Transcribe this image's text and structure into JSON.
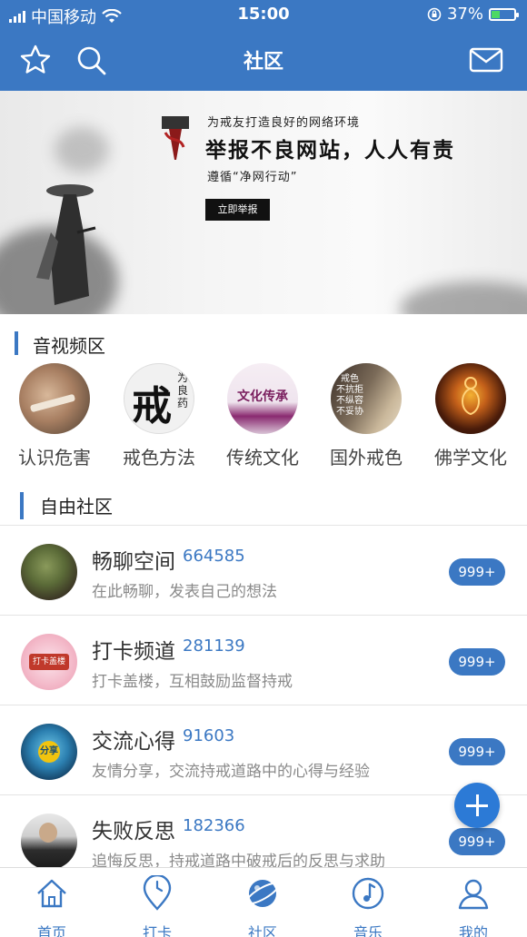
{
  "status_bar": {
    "carrier": "中国移动",
    "time": "15:00",
    "battery": "37%",
    "battery_level": 0.37
  },
  "nav": {
    "title": "社区",
    "left_icons": [
      "star-icon",
      "search-icon"
    ],
    "right_icon": "mail-icon"
  },
  "banner": {
    "sub": "为戒友打造良好的网络环境",
    "headline": "举报不良网站，人人有责",
    "sub2": "遵循“净网行动”",
    "button": "立即举报"
  },
  "video_section": {
    "title": "音视频区",
    "items": [
      {
        "label": "认识危害"
      },
      {
        "label": "戒色方法",
        "thumb_text": "戒",
        "thumb_text2": "为良药"
      },
      {
        "label": "传统文化",
        "thumb_text": "文化传承"
      },
      {
        "label": "国外戒色",
        "thumb_text": "戒色\n不抗拒\n不纵容\n不妥协"
      },
      {
        "label": "佛学文化"
      }
    ]
  },
  "community": {
    "title": "自由社区",
    "rows": [
      {
        "name": "畅聊空间",
        "count": "664585",
        "desc": "在此畅聊，发表自己的想法",
        "badge": "999+"
      },
      {
        "name": "打卡频道",
        "count": "281139",
        "desc": "打卡盖楼，互相鼓励监督持戒",
        "badge": "999+",
        "thumb_text": "打卡盖楼"
      },
      {
        "name": "交流心得",
        "count": "91603",
        "desc": "友情分享，交流持戒道路中的心得与经验",
        "badge": "999+",
        "thumb_text": "分享"
      },
      {
        "name": "失败反思",
        "count": "182366",
        "desc": "追悔反思，持戒道路中破戒后的反思与求助",
        "badge": "999+"
      }
    ]
  },
  "tabs": [
    {
      "label": "首页",
      "icon": "home-icon"
    },
    {
      "label": "打卡",
      "icon": "checkin-icon"
    },
    {
      "label": "社区",
      "icon": "planet-icon",
      "active": true
    },
    {
      "label": "音乐",
      "icon": "music-icon"
    },
    {
      "label": "我的",
      "icon": "profile-icon"
    }
  ],
  "colors": {
    "primary": "#3b78c3",
    "fab": "#2c7ad6",
    "badge": "#3b78c3"
  }
}
